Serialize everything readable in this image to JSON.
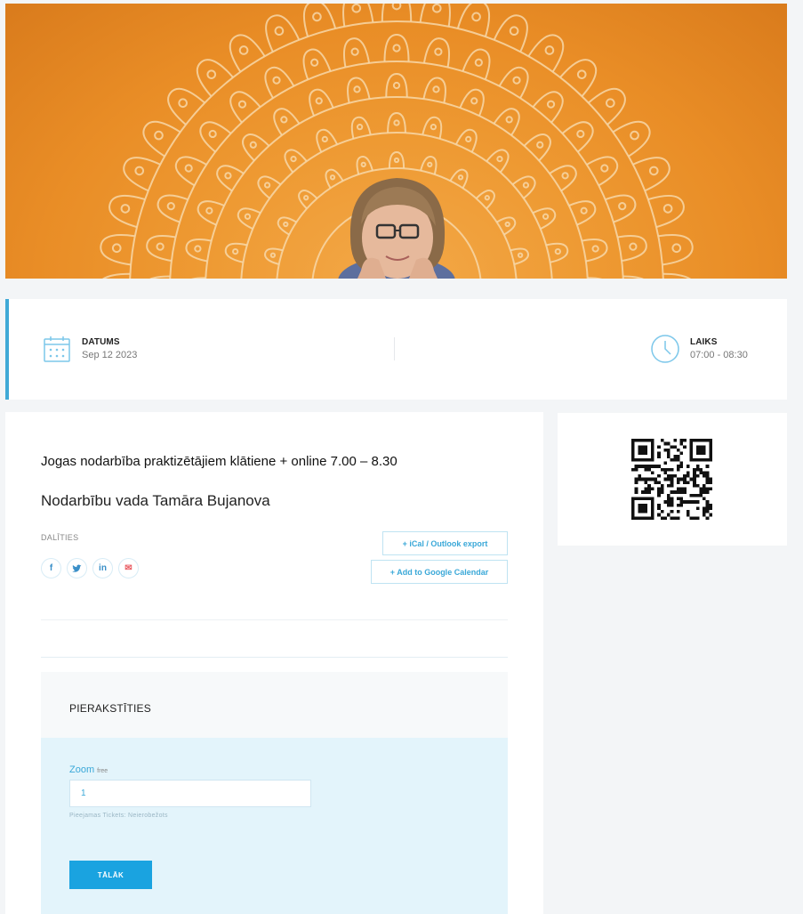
{
  "info": {
    "date_label": "DATUMS",
    "date_value": "Sep 12 2023",
    "time_label": "LAIKS",
    "time_value": "07:00 - 08:30"
  },
  "event": {
    "title": "Jogas nodarbība praktizētājiem klātiene + online 7.00 – 8.30",
    "subtitle": "Nodarbību vada Tamāra Bujanova"
  },
  "share": {
    "label": "DALĪTIES",
    "buttons": [
      {
        "icon": "facebook-icon",
        "glyph": "f"
      },
      {
        "icon": "twitter-icon",
        "glyph": "♥"
      },
      {
        "icon": "linkedin-icon",
        "glyph": "in"
      },
      {
        "icon": "email-icon",
        "glyph": "✉"
      }
    ]
  },
  "calendar": {
    "ical_label": "+ iCal / Outlook export",
    "google_label": "+ Add to Google Calendar"
  },
  "registration": {
    "title": "PIERAKSTĪTIES",
    "ticket_name": "Zoom",
    "ticket_price": "free",
    "quantity": "1",
    "availability": "Pieejamas Tickets: Neierobežots",
    "next_label": "TĀLĀK"
  },
  "colors": {
    "accent": "#1aa3e0",
    "hero_orange": "#ee9a33",
    "panel_light_blue": "#e3f4fb"
  }
}
